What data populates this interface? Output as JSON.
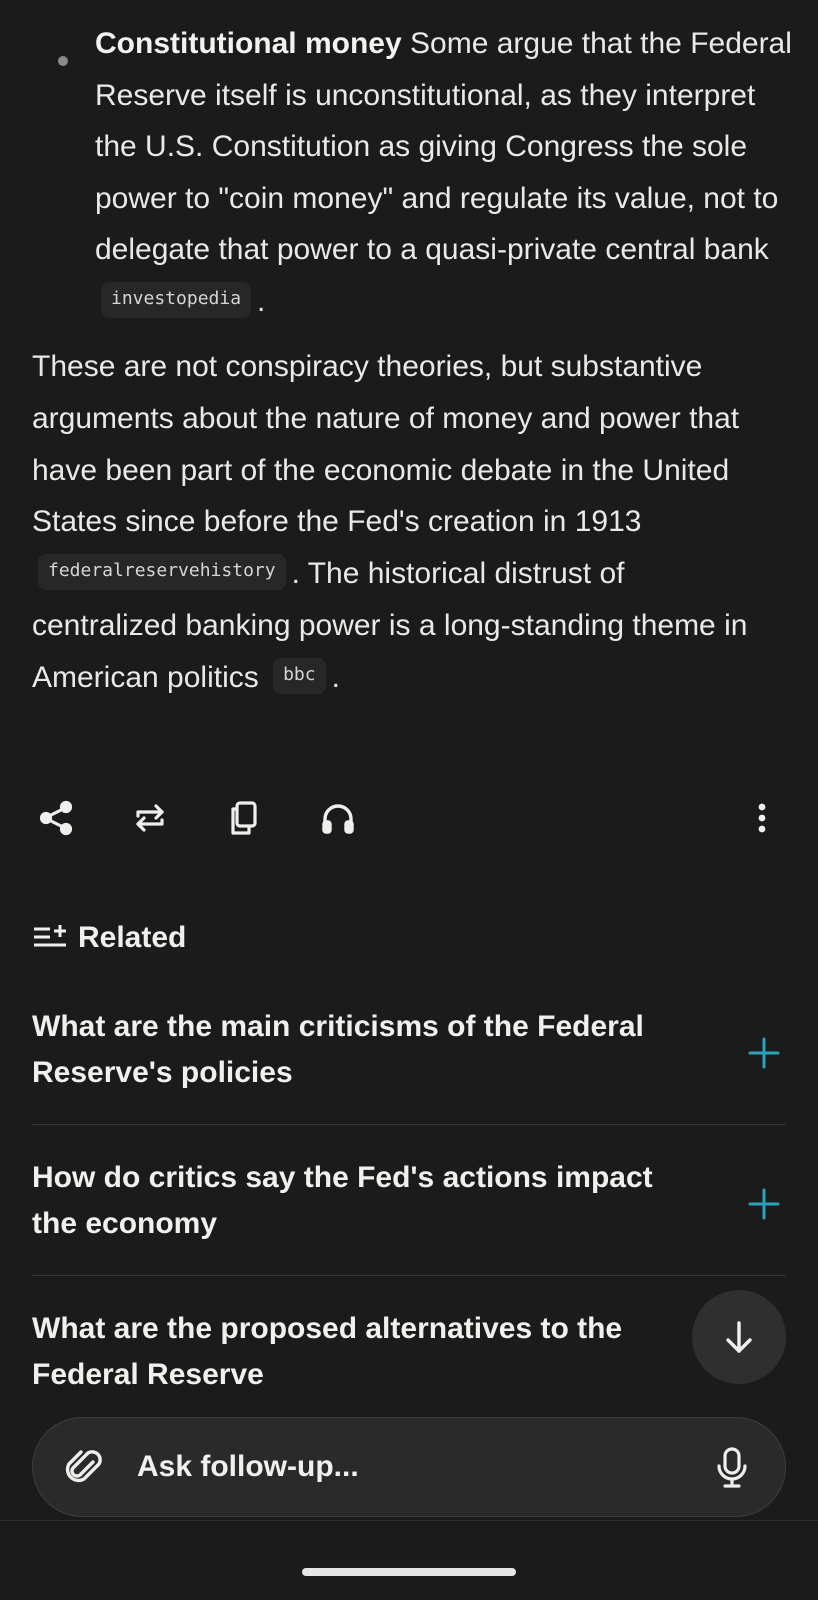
{
  "bullet": {
    "title": "Constitutional money",
    "text": " Some argue that the Federal Reserve itself is unconstitutional, as they interpret the U.S. Constitution as giving Congress the sole power to \"coin money\" and regulate its value, not to delegate that power to a quasi-private central bank",
    "cite": "investopedia",
    "end": "."
  },
  "paragraph": {
    "part1": "These are not conspiracy theories, but substantive arguments about the nature of money and power that have been part of the economic debate in the United States since before the Fed's creation in 1913",
    "cite1": "federalreservehistory",
    "part2": ". The historical distrust of centralized banking power is a long-standing theme in American politics",
    "cite2": "bbc",
    "end": "."
  },
  "actions": {
    "share_icon": "share-icon",
    "rewrite_icon": "repeat-icon",
    "copy_icon": "copy-icon",
    "listen_icon": "headphones-icon",
    "more_icon": "more-vertical-icon"
  },
  "related": {
    "label": "Related",
    "items": [
      "What are the main criticisms of the Federal Reserve's policies",
      "How do critics say the Fed's actions impact the economy",
      "What are the proposed alternatives to the Federal Reserve"
    ]
  },
  "input": {
    "placeholder": "Ask follow-up..."
  },
  "colors": {
    "background": "#1b1b1b",
    "accent": "#2aa3b8",
    "text": "#e9e9e6"
  }
}
